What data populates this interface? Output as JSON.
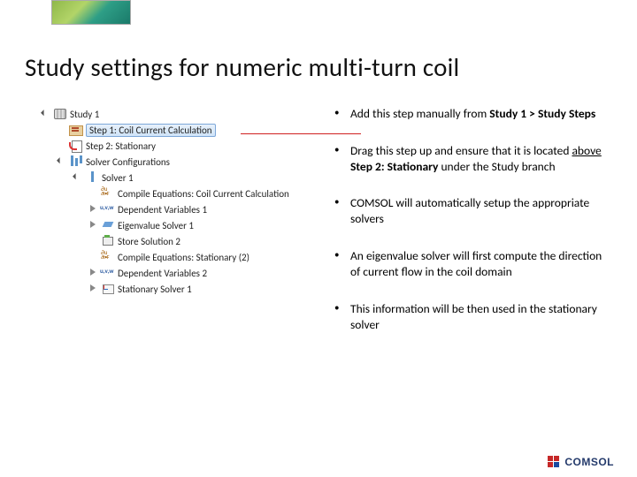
{
  "title": "Study settings for numeric multi-turn coil",
  "tree": {
    "study": "Study 1",
    "step1": "Step 1: Coil Current Calculation",
    "step2": "Step 2: Stationary",
    "solverconf": "Solver Configurations",
    "solver": "Solver 1",
    "compile1": "Compile Equations: Coil Current Calculation",
    "dep1": "Dependent Variables 1",
    "eig": "Eigenvalue Solver 1",
    "store": "Store Solution 2",
    "compile2": "Compile Equations: Stationary (2)",
    "dep2": "Dependent Variables 2",
    "stat": "Stationary Solver 1"
  },
  "bullets": {
    "b1_pre": "Add this step manually from ",
    "b1_bold": "Study 1 > Study Steps",
    "b2_pre": "Drag this step up and ensure that it is located ",
    "b2_u": "above",
    "b2_mid": " ",
    "b2_bold": "Step 2: Stationary",
    "b2_post": " under the Study branch",
    "b3": "COMSOL will automatically setup the appropriate solvers",
    "b4": "An eigenvalue solver will first compute the direction of current flow in the coil domain",
    "b5": "This information will be then used in the stationary solver"
  },
  "footer": {
    "brand": "COMSOL"
  }
}
